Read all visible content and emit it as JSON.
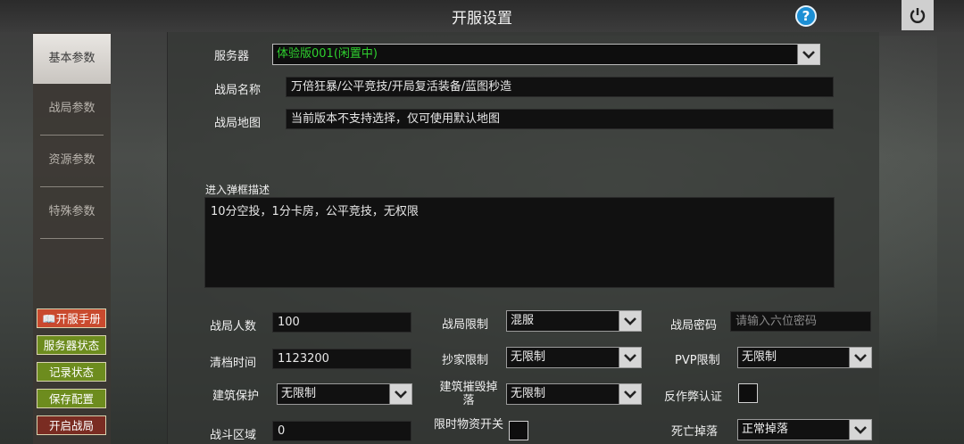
{
  "header": {
    "title": "开服设置",
    "help_glyph": "?"
  },
  "sidebar": {
    "tabs": [
      {
        "label": "基本参数"
      },
      {
        "label": "战局参数"
      },
      {
        "label": "资源参数"
      },
      {
        "label": "特殊参数"
      }
    ],
    "buttons": {
      "manual": "开服手册",
      "server_status": "服务器状态",
      "record_status": "记录状态",
      "save_config": "保存配置",
      "start_match": "开启战局"
    }
  },
  "form": {
    "server_label": "服务器",
    "server_value": "体验版001(闲置中)",
    "match_name_label": "战局名称",
    "match_name_value": "万倍狂暴/公平竞技/开局复活装备/蓝图秒造",
    "match_map_label": "战局地图",
    "match_map_value": "当前版本不支持选择，仅可使用默认地图",
    "popup_desc_label": "进入弹框描述",
    "popup_desc_value": "10分空投，1分卡房，公平竞技，无权限",
    "player_count_label": "战局人数",
    "player_count_value": "100",
    "clear_time_label": "清档时间",
    "clear_time_value": "1123200",
    "build_protect_label": "建筑保护",
    "build_protect_value": "无限制",
    "battle_zone_label": "战斗区域",
    "battle_zone_value": "0",
    "match_limit_label": "战局限制",
    "match_limit_value": "混服",
    "raid_limit_label": "抄家限制",
    "raid_limit_value": "无限制",
    "build_destroy_label": "建筑摧毁掉落",
    "build_destroy_value": "无限制",
    "timed_supply_label": "限时物资开关",
    "password_label": "战局密码",
    "password_placeholder": "请输入六位密码",
    "pvp_label": "PVP限制",
    "pvp_value": "无限制",
    "anticheat_label": "反作弊认证",
    "death_drop_label": "死亡掉落",
    "death_drop_value": "正常掉落"
  },
  "colors": {
    "server_text": "#2fd02f",
    "help_blue": "#1c8fd4",
    "manual_btn": "#c94a2e",
    "status_btn": "#6d8c1e",
    "start_btn": "#7a2c22"
  }
}
